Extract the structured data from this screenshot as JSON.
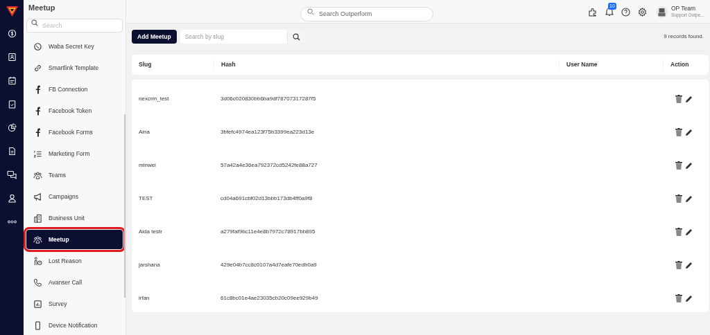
{
  "page_title": "Meetup",
  "sidebar": {
    "search": {
      "placeholder": "Search"
    },
    "items": [
      {
        "label": "Waba Secret Key",
        "selected": false
      },
      {
        "label": "Smartlink Template",
        "selected": false
      },
      {
        "label": "FB Connection",
        "selected": false
      },
      {
        "label": "Facebook Token",
        "selected": false
      },
      {
        "label": "Facebook Forms",
        "selected": false
      },
      {
        "label": "Marketing Form",
        "selected": false
      },
      {
        "label": "Teams",
        "selected": false
      },
      {
        "label": "Campaigns",
        "selected": false
      },
      {
        "label": "Business Unit",
        "selected": false
      },
      {
        "label": "Meetup",
        "selected": true
      },
      {
        "label": "Lost Reason",
        "selected": false
      },
      {
        "label": "Avanser Call",
        "selected": false
      },
      {
        "label": "Survey",
        "selected": false
      },
      {
        "label": "Device Notification",
        "selected": false
      }
    ]
  },
  "header": {
    "search": {
      "placeholder": "Search Outperform"
    },
    "notification_count": "10",
    "user": {
      "name": "OP Team",
      "role": "Support Outpe..."
    }
  },
  "toolbar": {
    "add_button": "Add Meetup",
    "search": {
      "placeholder": "Search by slug"
    },
    "records": "9 records found."
  },
  "table": {
    "columns": [
      "Slug",
      "Hash",
      "User Name",
      "Action"
    ],
    "rows": [
      {
        "slug": "nexcrm_test",
        "hash": "3d06c020830bb6ba9df78707317287f5",
        "user_name": ""
      },
      {
        "slug": "Aina",
        "hash": "3bfefc4974ea123f75b3399ea223d13e",
        "user_name": ""
      },
      {
        "slug": "minwei",
        "hash": "57a42a4e36ea792372cd5242fe88a727",
        "user_name": ""
      },
      {
        "slug": "TEST",
        "hash": "cd04a691cbf02d13bbb173db4ff0a9f8",
        "user_name": ""
      },
      {
        "slug": "Aida testr",
        "hash": "a279faf9bc11e4e8b7972c78917bb895",
        "user_name": ""
      },
      {
        "slug": "jarshana",
        "hash": "429e04b7cc8c0107a4d7eafe70edb0a9",
        "user_name": ""
      },
      {
        "slug": "irfan",
        "hash": "61c8bc01e4ae23035cb20c09ee929b49",
        "user_name": ""
      }
    ]
  }
}
